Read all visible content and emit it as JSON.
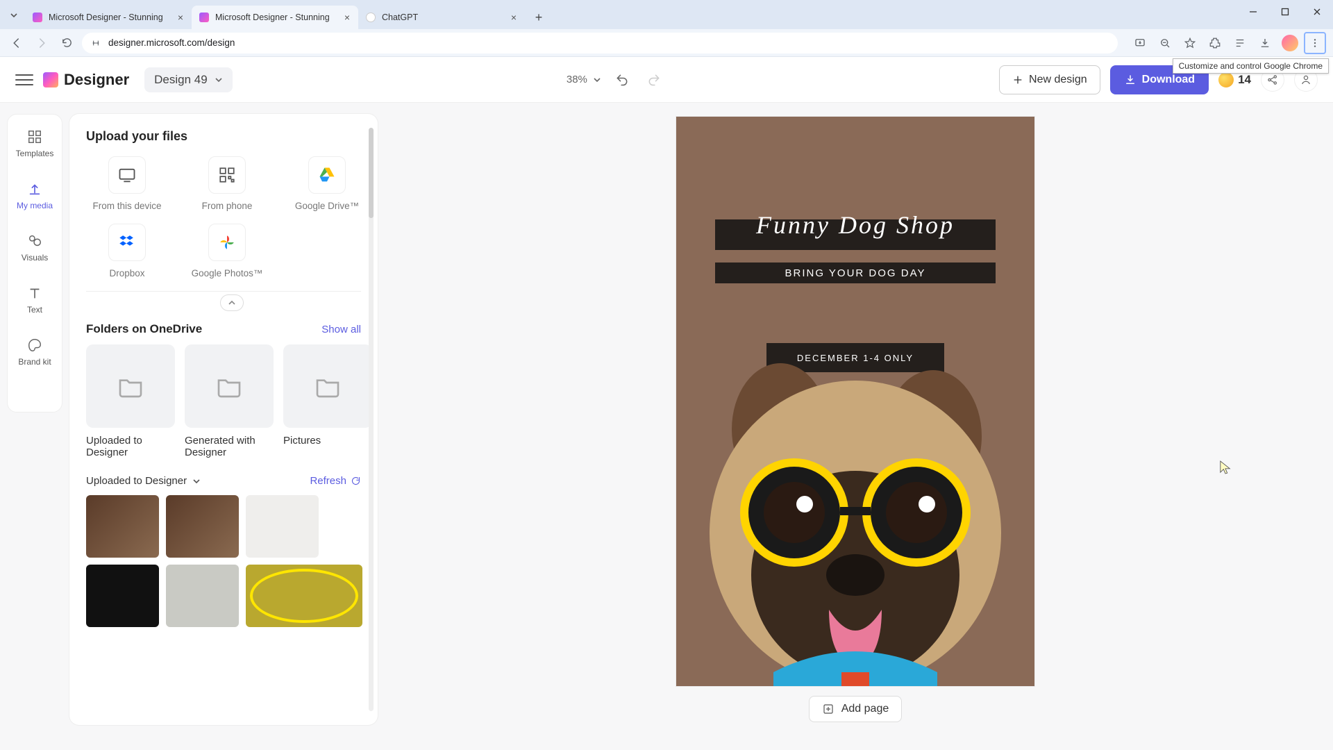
{
  "browser": {
    "tabs": [
      {
        "title": "Microsoft Designer - Stunning"
      },
      {
        "title": "Microsoft Designer - Stunning"
      },
      {
        "title": "ChatGPT"
      }
    ],
    "url": "designer.microsoft.com/design",
    "tooltip": "Customize and control Google Chrome"
  },
  "header": {
    "logo": "Designer",
    "design_name": "Design 49",
    "zoom": "38%",
    "new_design": "New design",
    "download": "Download",
    "coins": "14"
  },
  "rail": {
    "templates": "Templates",
    "mymedia": "My media",
    "visuals": "Visuals",
    "text": "Text",
    "brandkit": "Brand kit"
  },
  "panel": {
    "upload_title": "Upload your files",
    "sources": {
      "device": "From this device",
      "phone": "From phone",
      "gdrive": "Google Drive™",
      "dropbox": "Dropbox",
      "gphotos": "Google Photos™"
    },
    "folders_title": "Folders on OneDrive",
    "show_all": "Show all",
    "folders": [
      "Uploaded to Designer",
      "Generated with Designer",
      "Pictures"
    ],
    "uploads_title": "Uploaded to Designer",
    "refresh": "Refresh"
  },
  "canvas": {
    "title": "Funny Dog Shop",
    "subtitle": "BRING YOUR DOG DAY",
    "date": "DECEMBER 1-4 ONLY",
    "add_page": "Add page"
  }
}
